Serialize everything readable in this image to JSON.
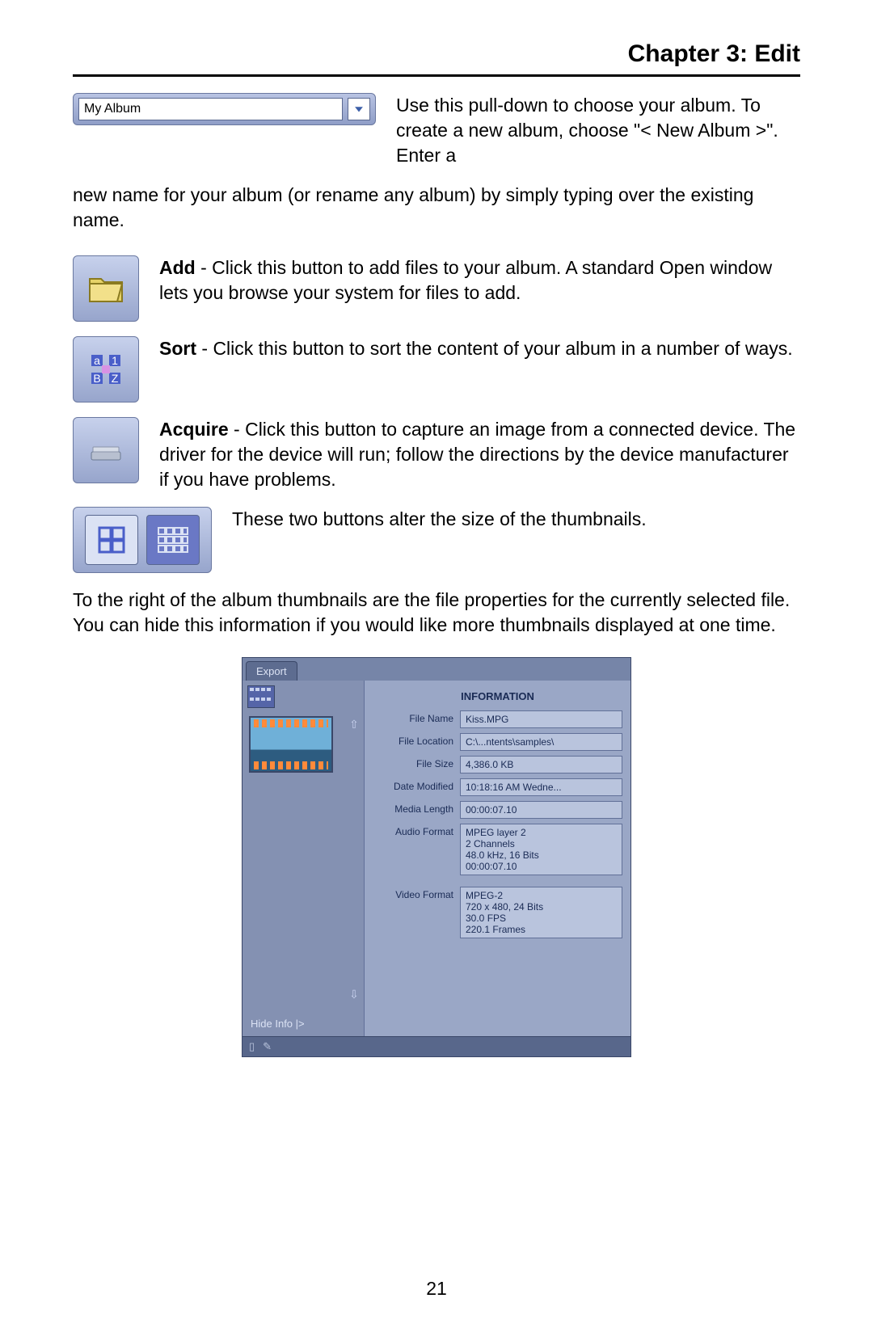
{
  "chapter_title": "Chapter 3:  Edit",
  "page_number": "21",
  "pulldown_value": "My Album",
  "text_pulldown_intro": "Use this pull-down to choose your album. To create a new album, choose \"< New Album >\". Enter a",
  "text_pulldown_cont": "new name for your album (or rename any album) by simply typing over the existing name.",
  "add_label": "Add",
  "add_text": " - Click this button to add files to your album. A standard Open window lets you browse your system for files to add.",
  "sort_label": "Sort",
  "sort_text": " - Click this button to sort the content of your album in a number of ways.",
  "acquire_label": "Acquire",
  "acquire_text": " - Click this button to capture an image from a connected device. The driver for the device will run; follow the directions by the device manufacturer if you have problems.",
  "thumb_text": "These two buttons alter the size of the thumbnails.",
  "props_text": "To the right of the album thumbnails are the file properties for the currently selected file. You can hide this information if you would like more thumbnails displayed at one time.",
  "info_panel": {
    "export_tab": "Export",
    "title": "INFORMATION",
    "hide_info": "Hide Info |>",
    "rows": [
      {
        "label": "File Name",
        "value": "Kiss.MPG"
      },
      {
        "label": "File Location",
        "value": "C:\\...ntents\\samples\\"
      },
      {
        "label": "File Size",
        "value": "4,386.0 KB"
      },
      {
        "label": "Date Modified",
        "value": "10:18:16 AM Wedne..."
      },
      {
        "label": "Media Length",
        "value": "00:00:07.10"
      },
      {
        "label": "Audio Format",
        "value": "MPEG layer 2\n2 Channels\n48.0 kHz, 16 Bits\n00:00:07.10"
      },
      {
        "label": "Video Format",
        "value": "MPEG-2\n720 x 480, 24 Bits\n30.0 FPS\n220.1 Frames"
      }
    ]
  }
}
